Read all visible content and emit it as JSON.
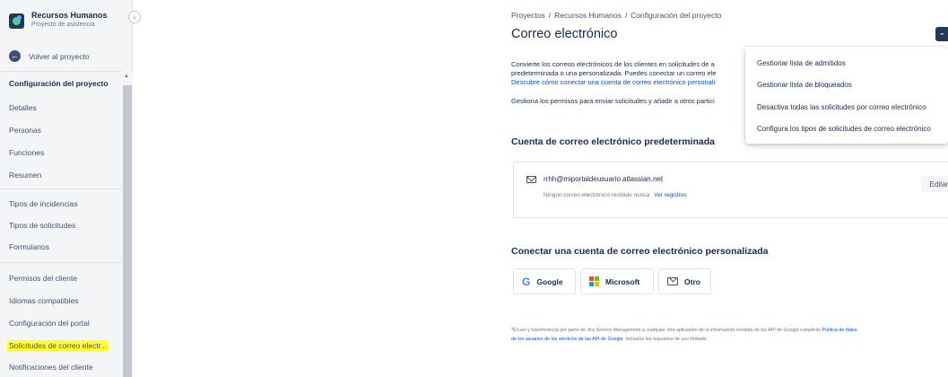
{
  "sidebar": {
    "project_name": "Recursos Humanos",
    "project_subtitle": "Proyecto de asistencia",
    "collapse_glyph": "‹",
    "back_label": "Volver al proyecto",
    "section_title": "Configuración del proyecto",
    "items": [
      {
        "label": "Detalles"
      },
      {
        "label": "Personas"
      },
      {
        "label": "Funciones"
      },
      {
        "label": "Resumen"
      },
      {
        "label": "Tipos de incidencias"
      },
      {
        "label": "Tipos de solicitudes"
      },
      {
        "label": "Formularios"
      },
      {
        "label": "Permisos del cliente"
      },
      {
        "label": "Idiomas compatibles"
      },
      {
        "label": "Configuración del portal"
      },
      {
        "label": "Solicitudes de correo electr..."
      },
      {
        "label": "Notificaciones del cliente"
      }
    ],
    "active_item": "Solicitudes de correo electr..."
  },
  "breadcrumb": [
    "Proyectos",
    "Recursos Humanos",
    "Configuración del proyecto"
  ],
  "breadcrumb_sep": "/",
  "page_title": "Correo electrónico",
  "more_button_glyph": "··",
  "description": {
    "line1": "Convierte los correos electrónicos de los clientes en solicitudes de a",
    "line2": "predeterminada o una personalizada. Puedes conectar un correo ele",
    "link": "Descubre cómo conectar una cuenta de correo electrónico personali",
    "line3": "Gestiona los permisos para enviar solicitudes y añadir a otros partici"
  },
  "default_section": {
    "title": "Cuenta de correo electrónico predeterminada",
    "email": "rrhh@miportaldeusuario.atlassian.net",
    "status": "Ningún correo electrónico recibido nunca",
    "logs_link": "Ver registros",
    "edit_label": "Editar"
  },
  "custom_section": {
    "title": "Conectar una cuenta de correo electrónico personalizada",
    "providers": [
      {
        "label": "Google",
        "icon": "google-icon"
      },
      {
        "label": "Microsoft",
        "icon": "microsoft-icon"
      },
      {
        "label": "Otro",
        "icon": "envelope-icon"
      }
    ]
  },
  "footnote": {
    "line1": "*El uso y transferencia por parte de Jira Service Management a cualquier otra aplicación de la información recibida de las API de Google cumplirán ",
    "line1_link": "Política de datos",
    "line2_link": "de los usuarios de los servicios de las API de Google",
    "line2": ", incluidos los requisitos de uso limitado."
  },
  "dropdown": {
    "items": [
      {
        "label": "Gestionar lista de admitidos"
      },
      {
        "label": "Gestionar lista de bloqueados"
      },
      {
        "label": "Desactiva todas las solicitudes por correo electrónico"
      },
      {
        "label": "Configura los tipos de solicitudes de correo electrónico"
      }
    ]
  },
  "colors": {
    "highlight": "#ffff33",
    "link": "#0052cc",
    "text": "#172b4d",
    "muted": "#6b778c",
    "sidebar_bg": "#f4f5f7",
    "more_button_bg": "#253858"
  }
}
